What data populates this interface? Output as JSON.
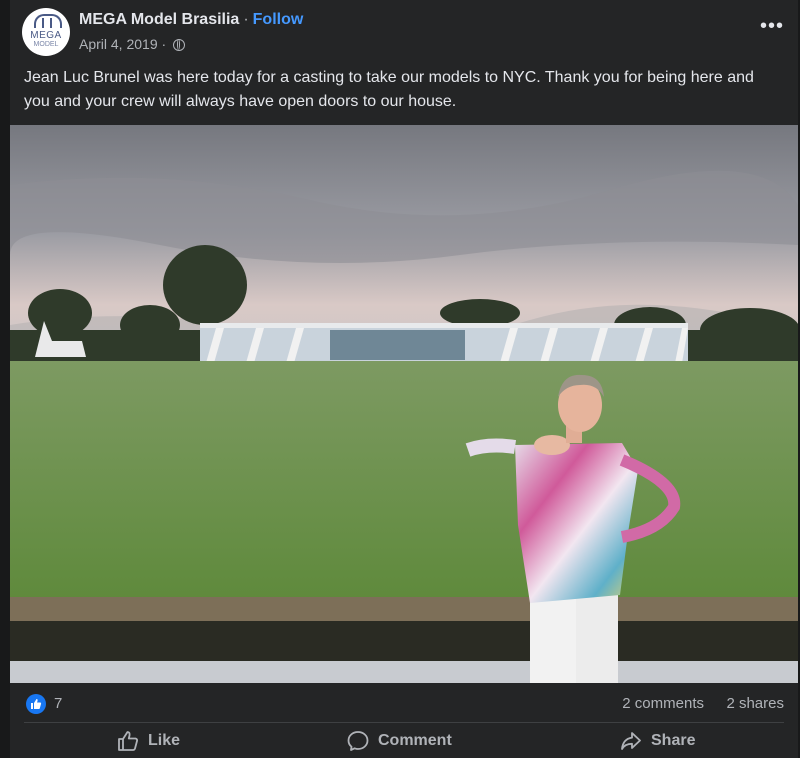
{
  "post": {
    "page_name": "MEGA Model Brasilia",
    "follow_label": "Follow",
    "date": "April 4, 2019",
    "caption": "Jean Luc Brunel was here today for a casting to take our models to NYC. Thank you for being here and you and your crew will always have open doors to our house.",
    "avatar_logo_text": "MEGA",
    "avatar_logo_sub": "MODEL"
  },
  "stats": {
    "reaction_count": "7",
    "comments": "2 comments",
    "shares": "2 shares"
  },
  "actions": {
    "like": "Like",
    "comment": "Comment",
    "share": "Share"
  },
  "icons": {
    "more": "more-options-icon",
    "globe": "globe-icon",
    "like_badge": "thumbs-up-icon",
    "like": "thumbs-up-outline-icon",
    "comment": "speech-bubble-icon",
    "share": "share-arrow-icon"
  },
  "colors": {
    "background": "#18191a",
    "card": "#242526",
    "link": "#4599ff",
    "like_badge": "#1877f2"
  }
}
